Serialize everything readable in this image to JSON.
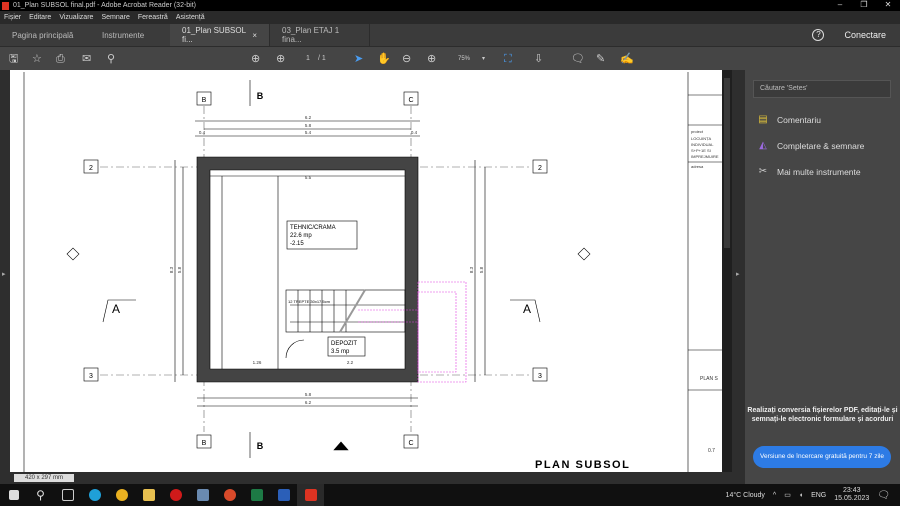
{
  "window": {
    "title": "01_Plan SUBSOL final.pdf - Adobe Acrobat Reader (32-bit)",
    "min": "–",
    "max": "❐",
    "close": "✕"
  },
  "menu": [
    "Fișier",
    "Editare",
    "Vizualizare",
    "Semnare",
    "Fereastră",
    "Asistență"
  ],
  "tabs": {
    "home": "Pagina principală",
    "tools": "Instrumente",
    "doc1": "01_Plan SUBSOL fi...",
    "doc1_close": "×",
    "doc2": "03_Plan ETAJ 1 fina...",
    "help": "?",
    "signin": "Conectare"
  },
  "toolbar": {
    "page_current": "1",
    "page_total": "/ 1",
    "zoom": "75%"
  },
  "drawing": {
    "axis_b": "B",
    "axis_c": "C",
    "axis_2": "2",
    "axis_3": "3",
    "section_a": "A",
    "section_b": "B",
    "dim_total": "6.2",
    "dim_axes": "5.8",
    "dim_inner": "5.4",
    "dim_side": "0.4",
    "dim_room": "5.5",
    "dim_left": "8.3",
    "dim_left2": "5.8",
    "room1_name": "TEHNIC/CRAMA",
    "room1_area": "22.6 mp",
    "room1_level": "-2.15",
    "room2_name": "DEPOZIT",
    "room2_area": "3.5 mp",
    "stairs": "12 TREPTE 30x17.5cm",
    "dim_bottom": "5.8",
    "dim_bottom2": "6.2",
    "dim_b1": "1.26",
    "dim_b2": "2.2",
    "title": "PLAN SUBSOL"
  },
  "title_block": {
    "role": "proiect",
    "lines": [
      "LOCUINȚA",
      "INDIVIDUAL",
      "S+P+1E SI",
      "IMPREJMUIRE"
    ],
    "section": "adresa",
    "bottom": "PLAN S",
    "scale": "0.7"
  },
  "panel": {
    "search_placeholder": "Căutare 'Setes'",
    "items": [
      "Comentariu",
      "Completare & semnare",
      "Mai multe instrumente"
    ],
    "promo": "Realizați conversia fișierelor PDF, editați-le și semnați-le electronic formulare și acorduri",
    "trial": "Versiune de încercare gratuită pentru 7 zile"
  },
  "status": {
    "page_size": "420 x 297 mm"
  },
  "taskbar": {
    "weather": "14°C  Cloudy",
    "lang": "ENG",
    "time": "23:43",
    "date": "15.05.2023"
  },
  "colors": {
    "accent": "#2d7be5",
    "comment": "#e0c23a",
    "sign": "#9b6ae0",
    "stairs_overlay": "#e040e0"
  }
}
